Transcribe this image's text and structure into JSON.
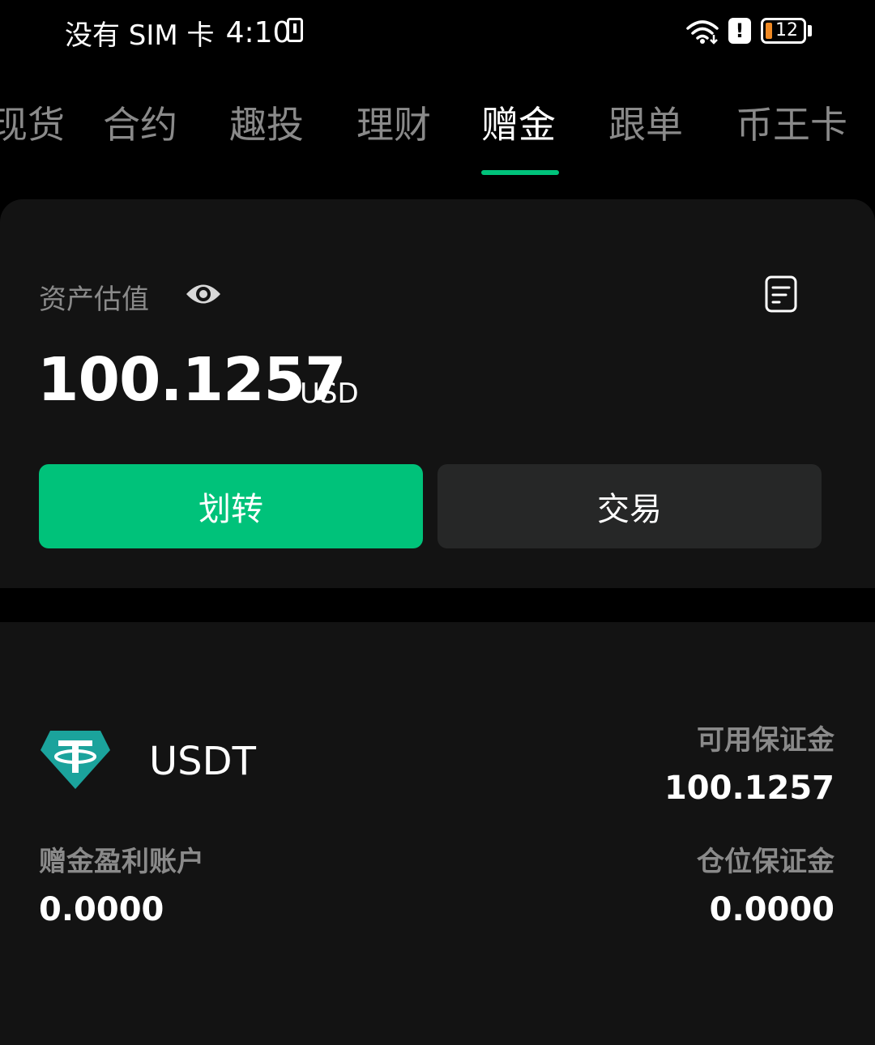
{
  "status_bar": {
    "carrier": "没有 SIM 卡",
    "time": "4:10",
    "battery_level": "12",
    "battery_color": "#f08a24"
  },
  "tabs": [
    {
      "label": "现货",
      "active": false
    },
    {
      "label": "合约",
      "active": false
    },
    {
      "label": "趣投",
      "active": false
    },
    {
      "label": "理财",
      "active": false
    },
    {
      "label": "赠金",
      "active": true
    },
    {
      "label": "跟单",
      "active": false
    },
    {
      "label": "币王卡",
      "active": false
    }
  ],
  "asset": {
    "label": "资产估值",
    "value": "100.1257",
    "unit": "USD",
    "transfer_label": "划转",
    "trade_label": "交易"
  },
  "account": {
    "coin": "USDT",
    "available_margin_label": "可用保证金",
    "available_margin_value": "100.1257",
    "profit_account_label": "赠金盈利账户",
    "profit_account_value": "0.0000",
    "position_margin_label": "仓位保证金",
    "position_margin_value": "0.0000"
  },
  "colors": {
    "accent": "#00c27a",
    "card": "#131313",
    "secondary_text": "#8a8a8a",
    "usdt": "#1ba39c"
  },
  "icons": [
    "wifi-icon",
    "alert-icon",
    "battery-icon",
    "eye-icon",
    "record-icon",
    "usdt-coin-icon"
  ]
}
